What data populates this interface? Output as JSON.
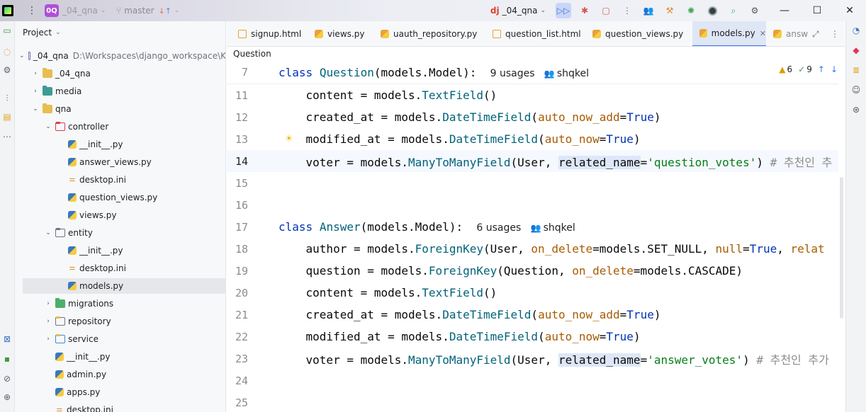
{
  "titlebar": {
    "project_badge": "0Q",
    "project_name": "_04_qna",
    "branch": "master",
    "run_config": "_04_qna"
  },
  "project_panel": {
    "title": "Project",
    "root_name": "_04_qna",
    "root_path": "D:\\Workspaces\\django_workspace\\K",
    "items": [
      {
        "label": "_04_qna"
      },
      {
        "label": "media"
      },
      {
        "label": "qna"
      },
      {
        "label": "controller"
      },
      {
        "label": "__init__.py"
      },
      {
        "label": "answer_views.py"
      },
      {
        "label": "desktop.ini"
      },
      {
        "label": "question_views.py"
      },
      {
        "label": "views.py"
      },
      {
        "label": "entity"
      },
      {
        "label": "__init__.py"
      },
      {
        "label": "desktop.ini"
      },
      {
        "label": "models.py"
      },
      {
        "label": "migrations"
      },
      {
        "label": "repository"
      },
      {
        "label": "service"
      },
      {
        "label": "__init__.py"
      },
      {
        "label": "admin.py"
      },
      {
        "label": "apps.py"
      },
      {
        "label": "desktop.ini"
      }
    ]
  },
  "tabs": [
    {
      "label": "signup.html"
    },
    {
      "label": "views.py"
    },
    {
      "label": "uauth_repository.py"
    },
    {
      "label": "question_list.html"
    },
    {
      "label": "question_views.py"
    },
    {
      "label": "models.py"
    },
    {
      "label": "answ"
    }
  ],
  "breadcrumb": "Question",
  "editor": {
    "warnings": "6",
    "ok_count": "9",
    "lines": [
      {
        "num": "7",
        "usages": "9 usages",
        "author": "shqkel"
      },
      {
        "num": "11"
      },
      {
        "num": "12"
      },
      {
        "num": "13"
      },
      {
        "num": "14"
      },
      {
        "num": "15"
      },
      {
        "num": "16"
      },
      {
        "num": "17",
        "usages": "6 usages",
        "author": "shqkel"
      },
      {
        "num": "18"
      },
      {
        "num": "19"
      },
      {
        "num": "20"
      },
      {
        "num": "21"
      },
      {
        "num": "22"
      },
      {
        "num": "23"
      },
      {
        "num": "24"
      },
      {
        "num": "25"
      }
    ],
    "comment_14": "# 추천인 추",
    "comment_23": "# 추천인 추가"
  }
}
